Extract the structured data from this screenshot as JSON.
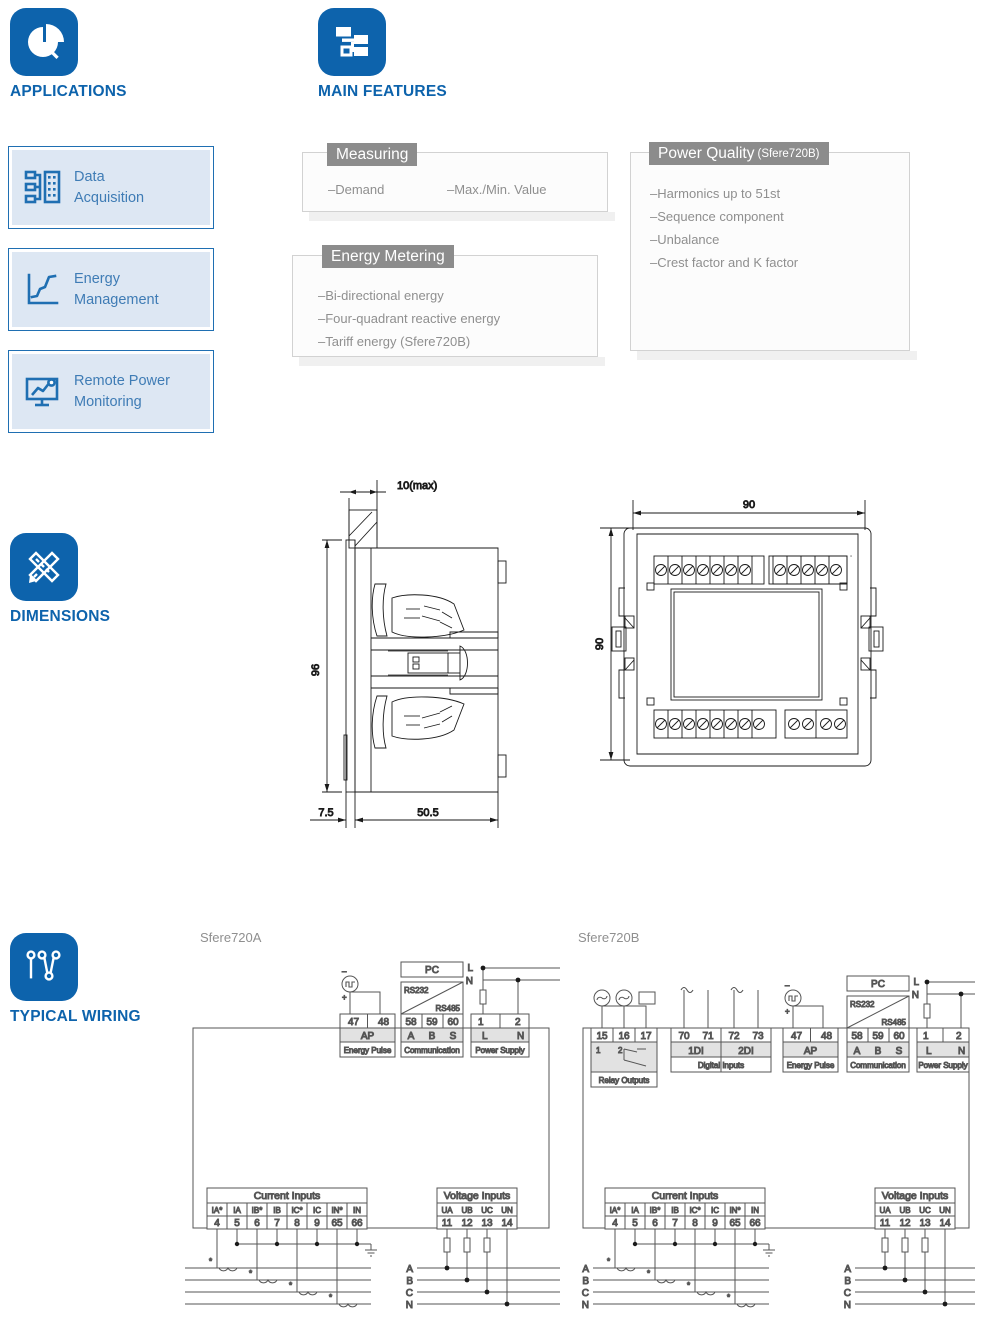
{
  "sections": {
    "applications": {
      "title": "APPLICATIONS",
      "icon": "pie-chart-icon"
    },
    "main_features": {
      "title": "MAIN FEATURES",
      "icon": "hierarchy-icon"
    },
    "dimensions": {
      "title": "DIMENSIONS",
      "icon": "ruler-pencil-icon"
    },
    "typical_wiring": {
      "title": "TYPICAL WIRING",
      "icon": "wiring-node-icon"
    }
  },
  "applications": {
    "cards": [
      {
        "line1": "Data",
        "line2": "Acquisition",
        "icon": "server-rack-icon"
      },
      {
        "line1": "Energy",
        "line2": "Management",
        "icon": "line-chart-icon"
      },
      {
        "line1": "Remote Power",
        "line2": "Monitoring",
        "icon": "monitor-chart-icon"
      }
    ]
  },
  "features": {
    "measuring": {
      "tag": "Measuring",
      "items": [
        "–Demand",
        "–Max./Min. Value"
      ]
    },
    "energy_metering": {
      "tag": "Energy Metering",
      "items": [
        "–Bi-directional energy",
        "–Four-quadrant reactive energy",
        "–Tariff energy (Sfere720B)"
      ]
    },
    "power_quality": {
      "tag": "Power Quality",
      "tag_note": "(Sfere720B)",
      "items": [
        "–Harmonics up to 51st",
        "–Sequence component",
        "–Unbalance",
        "–Crest factor and K factor"
      ]
    }
  },
  "dimensions": {
    "side_view": {
      "depth_front": "10(max)",
      "height": "96",
      "bezel": "7.5",
      "body_depth": "50.5"
    },
    "rear_view": {
      "width": "90",
      "height": "90"
    }
  },
  "wiring": {
    "models": [
      "Sfere720A",
      "Sfere720B"
    ],
    "blocks": {
      "relay_outputs": {
        "caption": "Relay Outputs",
        "terminals": [
          "15",
          "16",
          "17"
        ],
        "contacts": [
          "1",
          "2"
        ]
      },
      "digital_inputs": {
        "caption": "Digital Inputs",
        "terminals": [
          "70",
          "71",
          "72",
          "73"
        ],
        "groups": [
          "1DI",
          "2DI"
        ]
      },
      "energy_pulse": {
        "caption": "Energy Pulse",
        "terminals": [
          "47",
          "48"
        ],
        "label": "AP",
        "polarity": [
          "–",
          "+"
        ]
      },
      "communication": {
        "caption": "Communication",
        "terminals": [
          "58",
          "59",
          "60"
        ],
        "labels": [
          "A",
          "B",
          "S"
        ],
        "device": "PC",
        "standards": [
          "RS232",
          "RS485"
        ]
      },
      "power_supply": {
        "caption": "Power Supply",
        "terminals": [
          "1",
          "2"
        ],
        "labels": [
          "L",
          "N"
        ],
        "lines": [
          "L",
          "N"
        ]
      },
      "current_inputs": {
        "caption": "Current Inputs",
        "labels": [
          "IA*",
          "IA",
          "IB*",
          "IB",
          "IC*",
          "IC",
          "IN*",
          "IN"
        ],
        "terminals": [
          "4",
          "5",
          "6",
          "7",
          "8",
          "9",
          "65",
          "66"
        ],
        "phases": [
          "A",
          "B",
          "C",
          "N"
        ],
        "star_marks": 4
      },
      "voltage_inputs": {
        "caption": "Voltage Inputs",
        "labels": [
          "UA",
          "UB",
          "UC",
          "UN"
        ],
        "terminals": [
          "11",
          "12",
          "13",
          "14"
        ],
        "phases": [
          "A",
          "B",
          "C",
          "N"
        ],
        "fuses": 3
      }
    }
  },
  "colors": {
    "brand_blue": "#0d63ac",
    "card_border": "#1f6fb2",
    "card_fill": "#dde7f3",
    "card_text": "#3f7cb5",
    "tag_gray": "#8c8c8c",
    "body_text_gray": "#8f8f8f",
    "drawing_line": "#1a1a1a"
  }
}
